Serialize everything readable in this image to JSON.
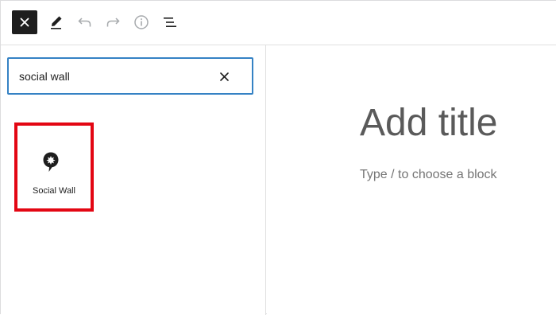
{
  "toolbar": {
    "close_icon": "close-icon",
    "edit_icon": "pencil-icon",
    "undo_icon": "undo-icon",
    "redo_icon": "redo-icon",
    "info_icon": "info-icon",
    "list_icon": "list-view-icon"
  },
  "inserter": {
    "search_value": "social wall",
    "clear_icon": "close-icon",
    "results": [
      {
        "label": "Social Wall",
        "icon": "social-wall-icon",
        "highlighted": true
      }
    ]
  },
  "editor": {
    "title_placeholder": "Add title",
    "block_placeholder": "Type / to choose a block"
  },
  "colors": {
    "accent": "#3582c4",
    "highlight": "#e30613",
    "dark": "#1e1e1e"
  }
}
